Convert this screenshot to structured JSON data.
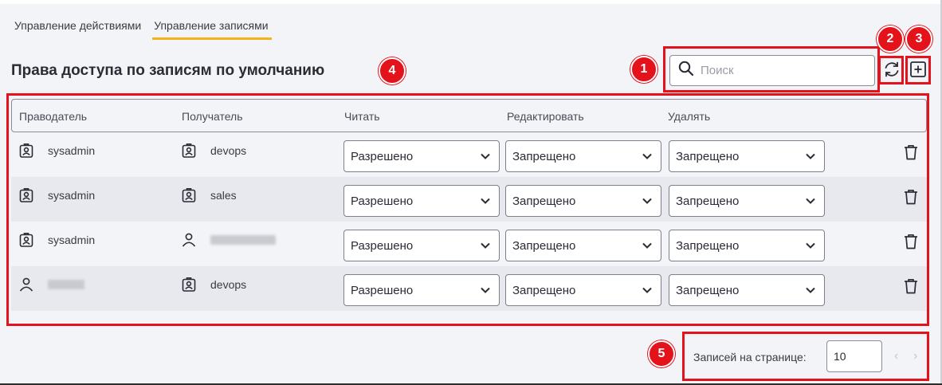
{
  "tabs": [
    {
      "label": "Управление действиями"
    },
    {
      "label": "Управление записями"
    }
  ],
  "page_title": "Права доступа по записям по умолчанию",
  "search": {
    "placeholder": "Поиск"
  },
  "columns": {
    "grantor": "Праводатель",
    "recipient": "Получатель",
    "read": "Читать",
    "edit": "Редактировать",
    "delete": "Удалять"
  },
  "rows": [
    {
      "grantor": "sysadmin",
      "grantor_type": "group",
      "recipient": "devops",
      "recipient_type": "group",
      "read": "Разрешено",
      "edit": "Запрещено",
      "delete": "Запрещено"
    },
    {
      "grantor": "sysadmin",
      "grantor_type": "group",
      "recipient": "sales",
      "recipient_type": "group",
      "read": "Разрешено",
      "edit": "Запрещено",
      "delete": "Запрещено"
    },
    {
      "grantor": "sysadmin",
      "grantor_type": "group",
      "recipient": "",
      "recipient_type": "user",
      "read": "Разрешено",
      "edit": "Запрещено",
      "delete": "Запрещено"
    },
    {
      "grantor": "",
      "grantor_type": "user",
      "recipient": "devops",
      "recipient_type": "group",
      "read": "Разрешено",
      "edit": "Запрещено",
      "delete": "Запрещено"
    }
  ],
  "pagination": {
    "label": "Записей на странице:",
    "page_size": "10"
  },
  "annotations": [
    "1",
    "2",
    "3",
    "4",
    "5"
  ],
  "colors": {
    "accent": "#f5b21a",
    "annotation": "#e3121b"
  }
}
